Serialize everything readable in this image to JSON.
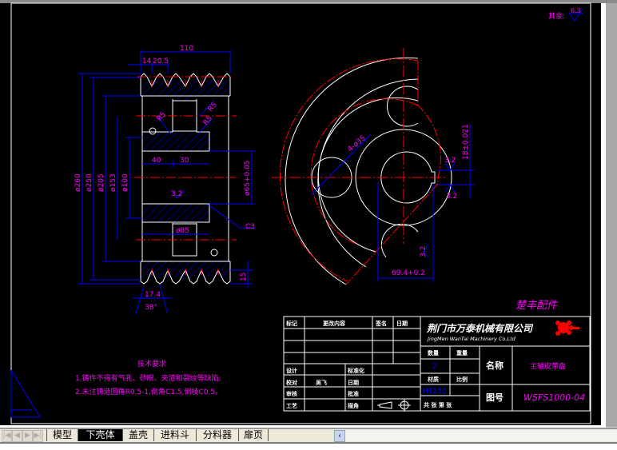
{
  "colors": {
    "background": "#000000",
    "outline": "#ffffff",
    "centerline": "#ff0000",
    "dimension": "#0000ff",
    "dimension_text": "#ff00ff"
  },
  "roughness": {
    "label": "其余:",
    "value": "6.3"
  },
  "left_view": {
    "dims": {
      "width": "110",
      "d14": "14",
      "d20_5": "20.5",
      "d260": "ø260",
      "d250": "ø250",
      "d205": "ø205",
      "d153": "ø153",
      "d100": "ø100",
      "l40": "40",
      "l30": "30",
      "r5a": "R5",
      "r5b": "R5",
      "r5c": "R5",
      "rough": "3.2",
      "d85": "ø85",
      "bore": "ø65+0.05",
      "chamfer": "C3",
      "h15": "15",
      "w17_4": "17.4",
      "angle": "38°"
    }
  },
  "right_view": {
    "dims": {
      "holes": "4-ø35",
      "keyway": "18±0.021",
      "rough1": "3.2",
      "rough2": "3.2",
      "rough3": "3.2",
      "depth": "69.4+0.2"
    }
  },
  "notes": {
    "title": "技术要求",
    "items": [
      "1.铸件不得有气孔、砂眼、夹渣和裂纹等缺陷;",
      "2.未注铸造圆角R0.5-1,倒角C1.5,倒棱C0.5。"
    ]
  },
  "stamp": "楚丰配件",
  "title_block": {
    "headers": [
      "标记",
      "更改内容",
      "签名",
      "日期"
    ],
    "rows": [
      [
        "设计",
        "",
        "标准化",
        ""
      ],
      [
        "校对",
        "吴飞",
        "日期",
        ""
      ],
      [
        "审核",
        "",
        "批准",
        ""
      ],
      [
        "工艺",
        "",
        "描角",
        ""
      ]
    ],
    "company_cn": "荆门市万泰机械有限公司",
    "company_en": "JingMen WanTai Machinery Co.Ltd",
    "qty_label": "数量",
    "weight_label": "重量",
    "qty_value": "2",
    "material_label": "材质",
    "scale_label": "比例",
    "material_value": "HT250",
    "sheet_label": "共 张 第 张",
    "name_label": "名称",
    "name_value": "主轴皮带盘",
    "drawing_no_label": "图号",
    "drawing_no_value": "WSFS1000-04"
  },
  "tabs": [
    {
      "label": "模型",
      "active": false
    },
    {
      "label": "下壳体",
      "active": true
    },
    {
      "label": "盖壳",
      "active": false
    },
    {
      "label": "进料斗",
      "active": false
    },
    {
      "label": "分料器",
      "active": false
    },
    {
      "label": "扉页",
      "active": false
    }
  ]
}
